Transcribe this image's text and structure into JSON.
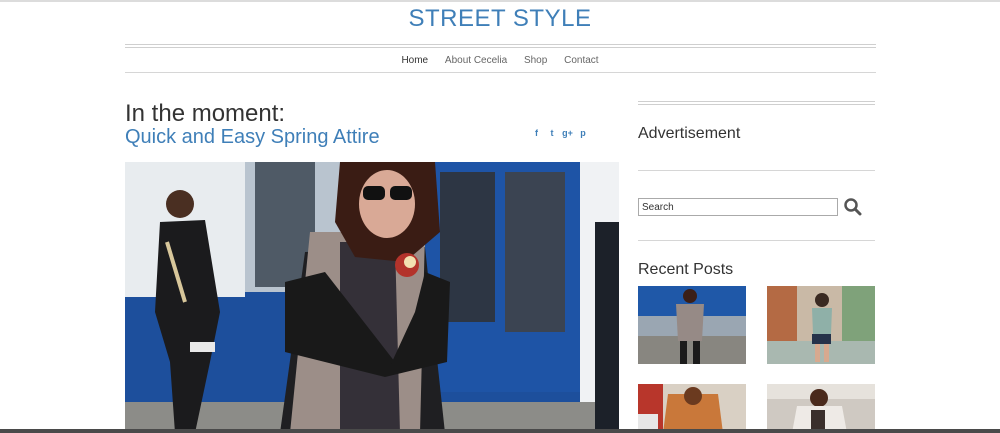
{
  "site": {
    "title": "STREET STYLE"
  },
  "nav": {
    "items": [
      "Home",
      "About Cecelia",
      "Shop",
      "Contact"
    ],
    "active": "Home"
  },
  "post": {
    "title_line1": "In the moment:",
    "title_line2": "Quick and Easy Spring Attire",
    "share_icons": [
      "f",
      "t",
      "g+",
      "p"
    ],
    "share_icon_names": [
      "facebook-icon",
      "twitter-icon",
      "google-plus-icon",
      "pinterest-icon"
    ]
  },
  "sidebar": {
    "advertisement_title": "Advertisement",
    "search": {
      "value": "Search",
      "placeholder": "Search"
    },
    "recent_posts_title": "Recent Posts",
    "recent_posts_count_visible": 4
  },
  "colors": {
    "accent": "#3f7fb8",
    "text": "#333333",
    "rule": "#cfcfcf"
  }
}
